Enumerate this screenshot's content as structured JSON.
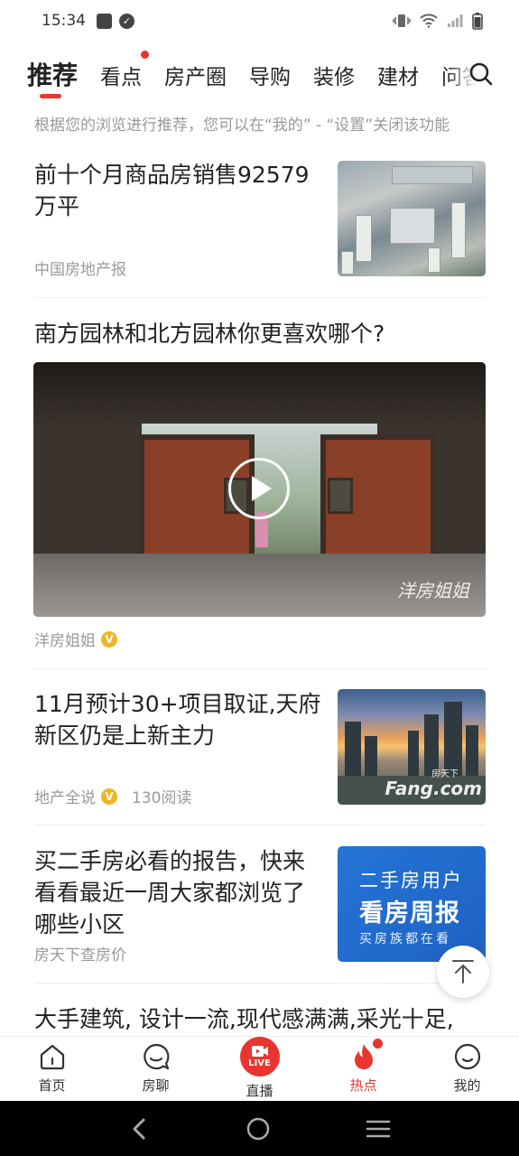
{
  "status": {
    "time": "15:34"
  },
  "tabs": [
    {
      "label": "推荐",
      "active": true,
      "dot": false
    },
    {
      "label": "看点",
      "active": false,
      "dot": true
    },
    {
      "label": "房产圈",
      "active": false,
      "dot": false
    },
    {
      "label": "导购",
      "active": false,
      "dot": false
    },
    {
      "label": "装修",
      "active": false,
      "dot": false
    },
    {
      "label": "建材",
      "active": false,
      "dot": false
    },
    {
      "label": "问答",
      "active": false,
      "dot": false
    }
  ],
  "hint": "根据您的浏览进行推荐，您可以在“我的” - “设置”关闭该功能",
  "feed": [
    {
      "title": "前十个月商品房销售92579万平",
      "source": "中国房地产报"
    },
    {
      "title": "南方园林和北方园林你更喜欢哪个?",
      "source": "洋房姐姐",
      "watermark": "洋房姐姐"
    },
    {
      "title": "11月预计30+项目取证,天府新区仍是上新主力",
      "source": "地产全说",
      "reads": "130阅读",
      "thumb_mark": "Fang.com",
      "thumb_mark_top": "房天下"
    },
    {
      "title": "买二手房必看的报告，快来看看最近一周大家都浏览了哪些小区",
      "source": "房天下查房价",
      "banner_line1": "二手房用户",
      "banner_line2": "看房周报",
      "banner_line3": "买房族都在看"
    },
    {
      "title": "大手建筑, 设计一流,现代感满满,采光十足,"
    }
  ],
  "verified_mark": "V",
  "bottom_nav": [
    {
      "label": "首页",
      "icon": "home-icon"
    },
    {
      "label": "房聊",
      "icon": "chat-icon"
    },
    {
      "label": "直播",
      "icon": "live-icon",
      "badge": "LIVE"
    },
    {
      "label": "热点",
      "icon": "flame-icon",
      "active": true
    },
    {
      "label": "我的",
      "icon": "profile-icon"
    }
  ],
  "colors": {
    "accent": "#e8352f",
    "banner": "#2474d6",
    "verified": "#f0b526"
  }
}
